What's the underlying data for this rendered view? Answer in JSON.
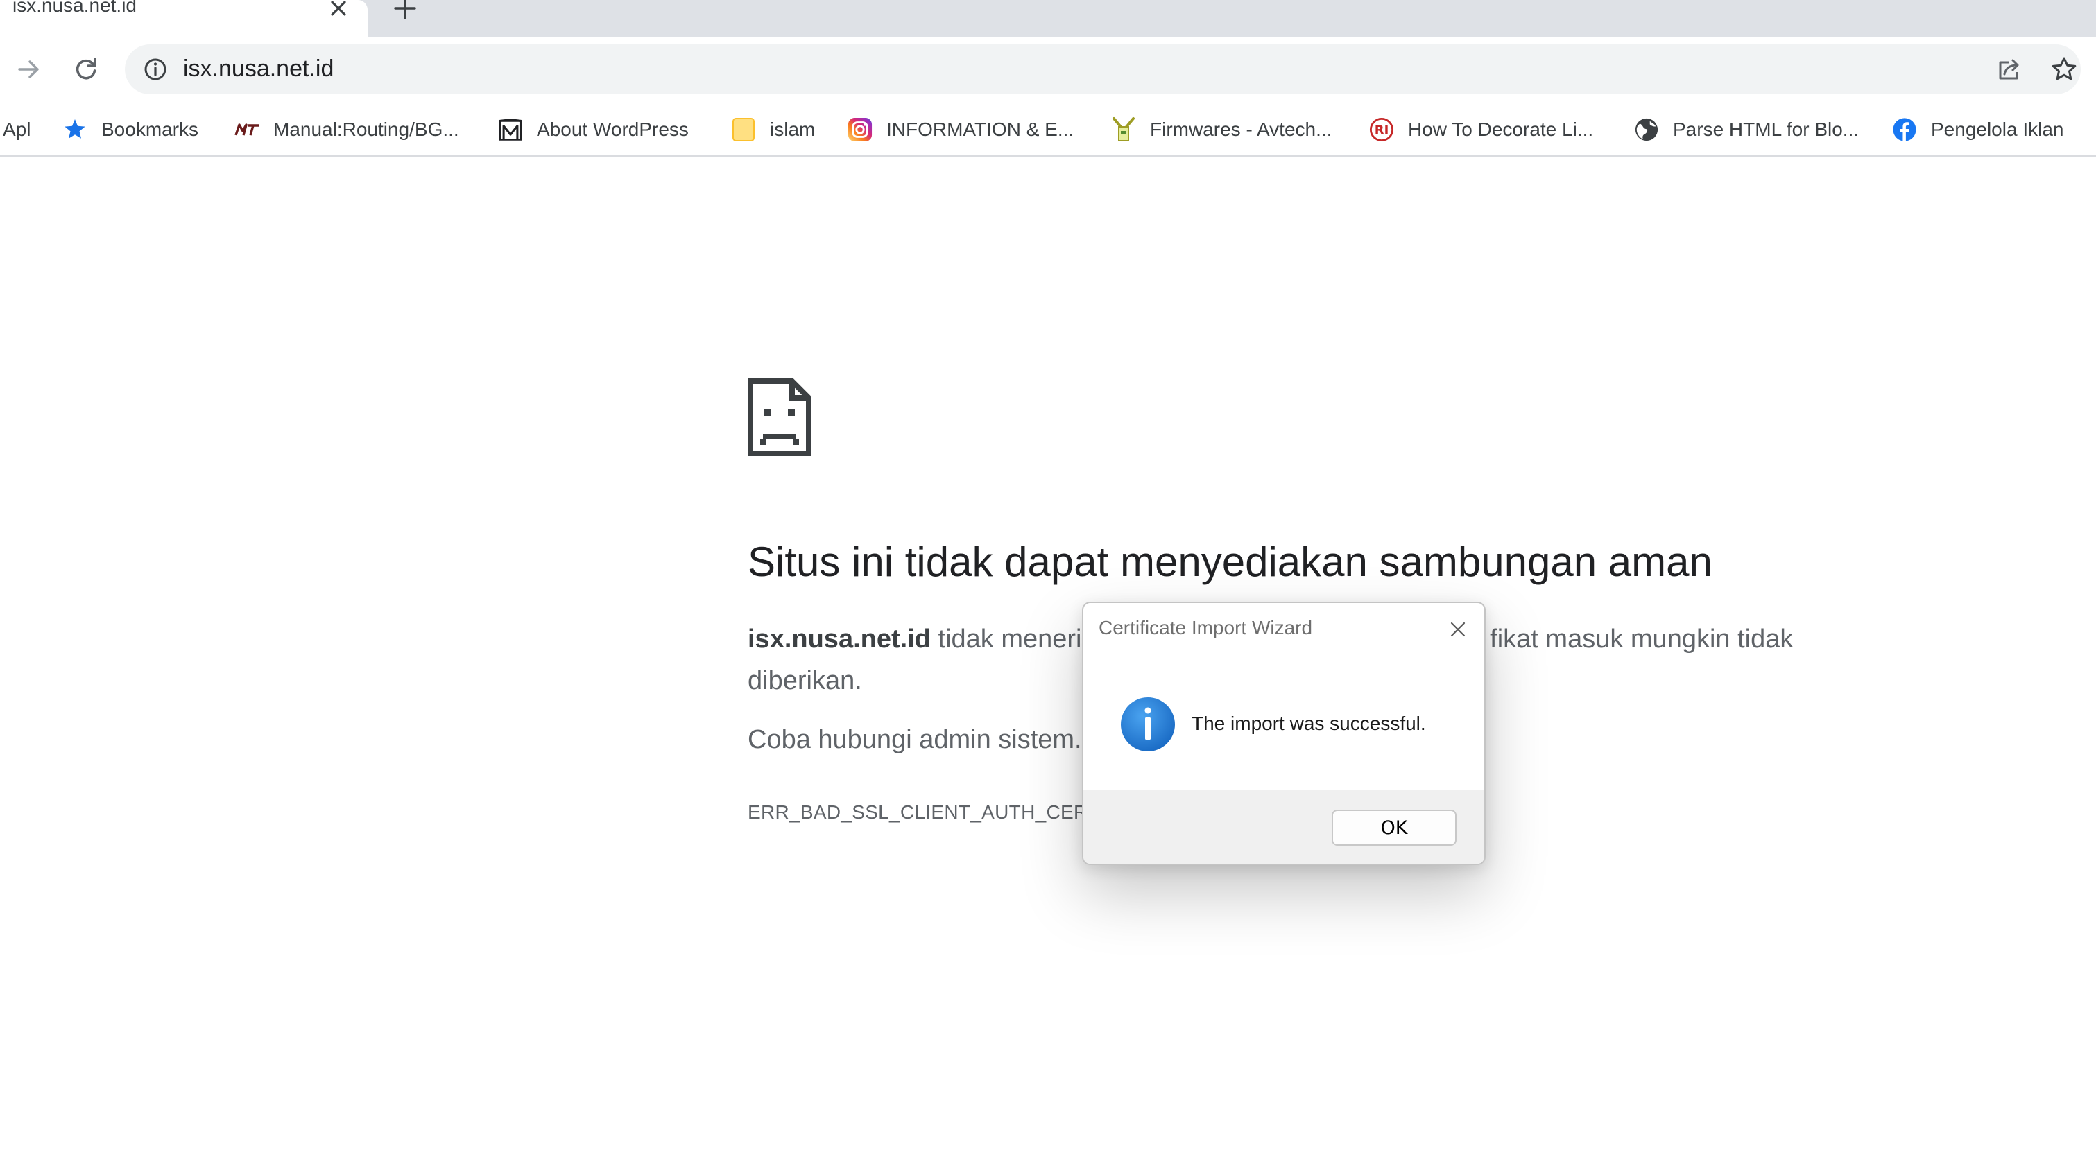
{
  "tab": {
    "title": "isx.nusa.net.id"
  },
  "toolbar": {
    "url": "isx.nusa.net.id"
  },
  "bookmarks": [
    {
      "label": "Apl",
      "icon": "none"
    },
    {
      "label": "Bookmarks",
      "icon": "star-icon"
    },
    {
      "label": "Manual:Routing/BG...",
      "icon": "mikrotik-logo-icon"
    },
    {
      "label": "About WordPress",
      "icon": "wordpress-icon"
    },
    {
      "label": "islam",
      "icon": "folder-icon"
    },
    {
      "label": "INFORMATION & E...",
      "icon": "instagram-icon"
    },
    {
      "label": "Firmwares - Avtech...",
      "icon": "avtech-icon"
    },
    {
      "label": "How To Decorate Li...",
      "icon": "ri-logo-icon"
    },
    {
      "label": "Parse HTML for Blo...",
      "icon": "globe-icon"
    },
    {
      "label": "Pengelola Iklan",
      "icon": "facebook-icon"
    }
  ],
  "error": {
    "heading": "Situs ini tidak dapat menyediakan sambungan aman",
    "domain": "isx.nusa.net.id",
    "desc_part1": " tidak menerir",
    "desc_part2": "fikat masuk mungkin tidak",
    "desc_line2": "diberikan.",
    "hint": "Coba hubungi admin sistem.",
    "code": "ERR_BAD_SSL_CLIENT_AUTH_CERT"
  },
  "dialog": {
    "title": "Certificate Import Wizard",
    "message": "The import was successful.",
    "ok_label": "OK"
  },
  "colors": {
    "accent_blue": "#1a73e8",
    "dialog_info_blue": "#1e88e5",
    "tab_strip": "#dee1e6",
    "omnibox": "#f1f3f4"
  }
}
